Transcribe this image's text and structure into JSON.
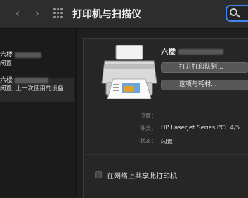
{
  "toolbar": {
    "title": "打印机与扫描仪",
    "back_label": "‹",
    "forward_label": "›"
  },
  "sidebar": {
    "items": [
      {
        "name": "六楼",
        "status": "闲置"
      },
      {
        "name": "六楼",
        "status": "闲置, 上一次使用的设备"
      }
    ]
  },
  "detail": {
    "printer_name": "六楼",
    "open_queue_label": "打开打印队列...",
    "options_label": "选项与耗材...",
    "location_label": "位置：",
    "location_value": "",
    "kind_label": "种类：",
    "kind_value": "HP LaserJet Series PCL 4/5",
    "status_label": "状态：",
    "status_value": "闲置",
    "share_label": "在网络上共享此打印机"
  },
  "colors": {
    "accent": "#3f86f0",
    "background": "#1f1f1f",
    "button": "#575757"
  },
  "icons": [
    "chevron-left-icon",
    "chevron-right-icon",
    "grid-icon",
    "search-icon",
    "printer-icon"
  ]
}
